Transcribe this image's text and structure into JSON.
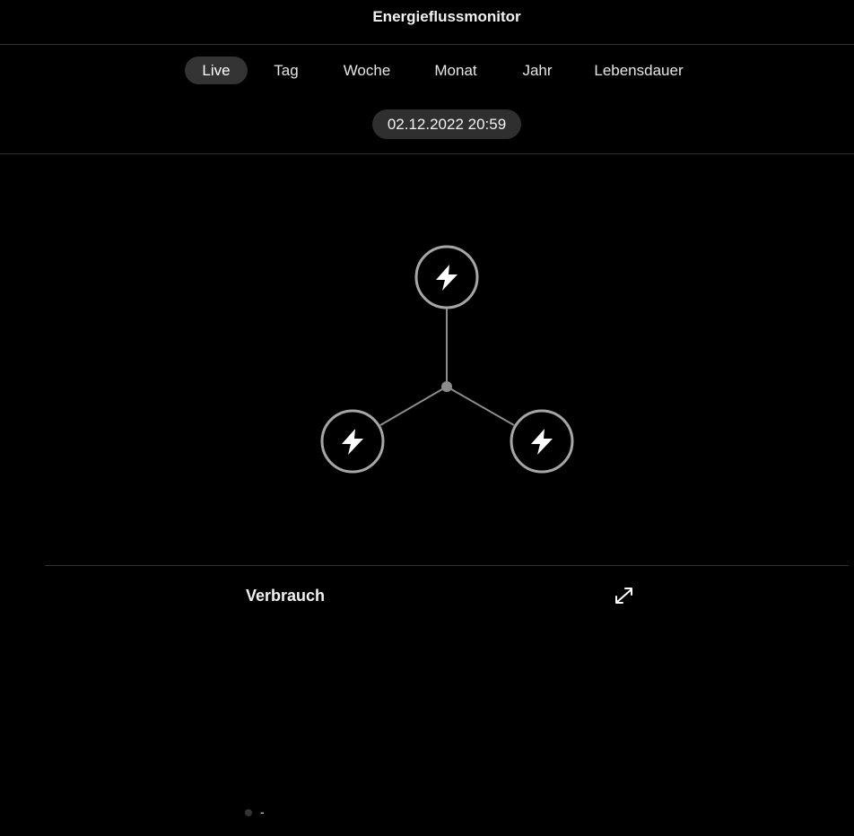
{
  "header": {
    "title": "Energieflussmonitor"
  },
  "tabs": [
    {
      "label": "Live",
      "active": true
    },
    {
      "label": "Tag",
      "active": false
    },
    {
      "label": "Woche",
      "active": false
    },
    {
      "label": "Monat",
      "active": false
    },
    {
      "label": "Jahr",
      "active": false
    },
    {
      "label": "Lebensdauer",
      "active": false
    }
  ],
  "timestamp": "02.12.2022 20:59",
  "flow": {
    "nodes": [
      {
        "icon": "lightning-icon"
      },
      {
        "icon": "lightning-icon"
      },
      {
        "icon": "lightning-icon"
      }
    ],
    "colors": {
      "ring": "#a6a6a6",
      "line": "#8c8c8c",
      "icon": "#ffffff"
    }
  },
  "consumption": {
    "title": "Verbrauch",
    "expand_icon": "expand-icon",
    "legend": {
      "label": "-"
    }
  }
}
